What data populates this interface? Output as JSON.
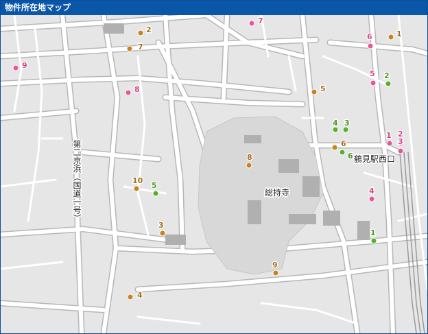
{
  "title": "物件所在地マップ",
  "colors": {
    "title_bg": "#0a56a8",
    "pin_brown": "#c8821e",
    "pin_green": "#58b02a",
    "pin_pink": "#e8559a",
    "label_brown": "#a3701e",
    "label_green": "#4e9a1e",
    "label_pink": "#d6458a"
  },
  "place_labels": {
    "route": "第二京浜（国道一号）",
    "temple": "総持寺",
    "station": "鶴見駅西口"
  },
  "markers": [
    {
      "label": "1",
      "color": "brown"
    },
    {
      "label": "2",
      "color": "brown"
    },
    {
      "label": "7",
      "color": "brown"
    },
    {
      "label": "5",
      "color": "brown"
    },
    {
      "label": "4",
      "color": "green"
    },
    {
      "label": "3",
      "color": "green"
    },
    {
      "label": "6",
      "color": "brown"
    },
    {
      "label": "6",
      "color": "green"
    },
    {
      "label": "8",
      "color": "brown"
    },
    {
      "label": "10",
      "color": "brown"
    },
    {
      "label": "5",
      "color": "green"
    },
    {
      "label": "3",
      "color": "brown"
    },
    {
      "label": "9",
      "color": "brown"
    },
    {
      "label": "4",
      "color": "brown"
    },
    {
      "label": "2",
      "color": "green"
    },
    {
      "label": "1",
      "color": "green"
    },
    {
      "label": "7",
      "color": "pink"
    },
    {
      "label": "6",
      "color": "pink"
    },
    {
      "label": "9",
      "color": "pink"
    },
    {
      "label": "8",
      "color": "pink"
    },
    {
      "label": "5",
      "color": "pink"
    },
    {
      "label": "1",
      "color": "pink"
    },
    {
      "label": "2",
      "color": "pink"
    },
    {
      "label": "3",
      "color": "pink"
    },
    {
      "label": "4",
      "color": "pink"
    }
  ]
}
